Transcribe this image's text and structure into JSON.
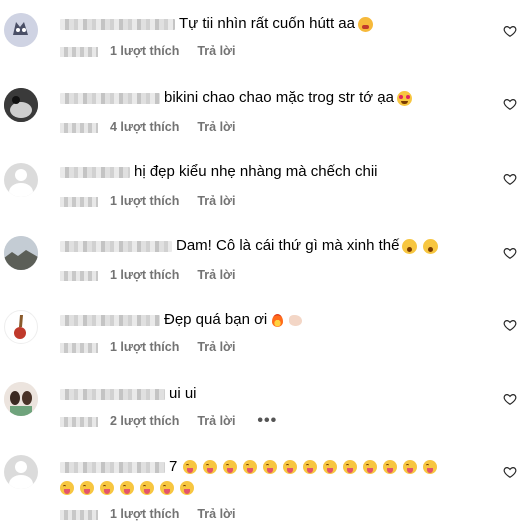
{
  "comments": [
    {
      "text": "Tự tii nhìn rất cuốn hútt aa",
      "emoji": "cry-face-icon",
      "likes": "1 lượt thích",
      "reply": "Trả lời"
    },
    {
      "text": "bikini chao chao mặc trog str tớ ạa",
      "emoji": "heart-eyes-face-icon",
      "likes": "4 lượt thích",
      "reply": "Trả lời"
    },
    {
      "text": "hị đẹp kiểu nhẹ nhàng mà chếch chii",
      "likes": "1 lượt thích",
      "reply": "Trả lời"
    },
    {
      "text": "Dam! Cô là cái thứ gì mà xinh thế",
      "emoji": "astonished-face-icon",
      "likes": "1 lượt thích",
      "reply": "Trả lời"
    },
    {
      "text": "Đẹp quá bạn ơi",
      "emoji": "fire-icon",
      "likes": "1 lượt thích",
      "reply": "Trả lời"
    },
    {
      "text": "ui ui",
      "likes": "2 lượt thích",
      "reply": "Trả lời",
      "more": "•••"
    },
    {
      "text": "7",
      "emoji": "tongue-out-face-icon",
      "likes": "1 lượt thích",
      "reply": "Trả lời"
    }
  ],
  "colors": {
    "meta": "#737373",
    "avatar_default": "#dbdbdb"
  }
}
